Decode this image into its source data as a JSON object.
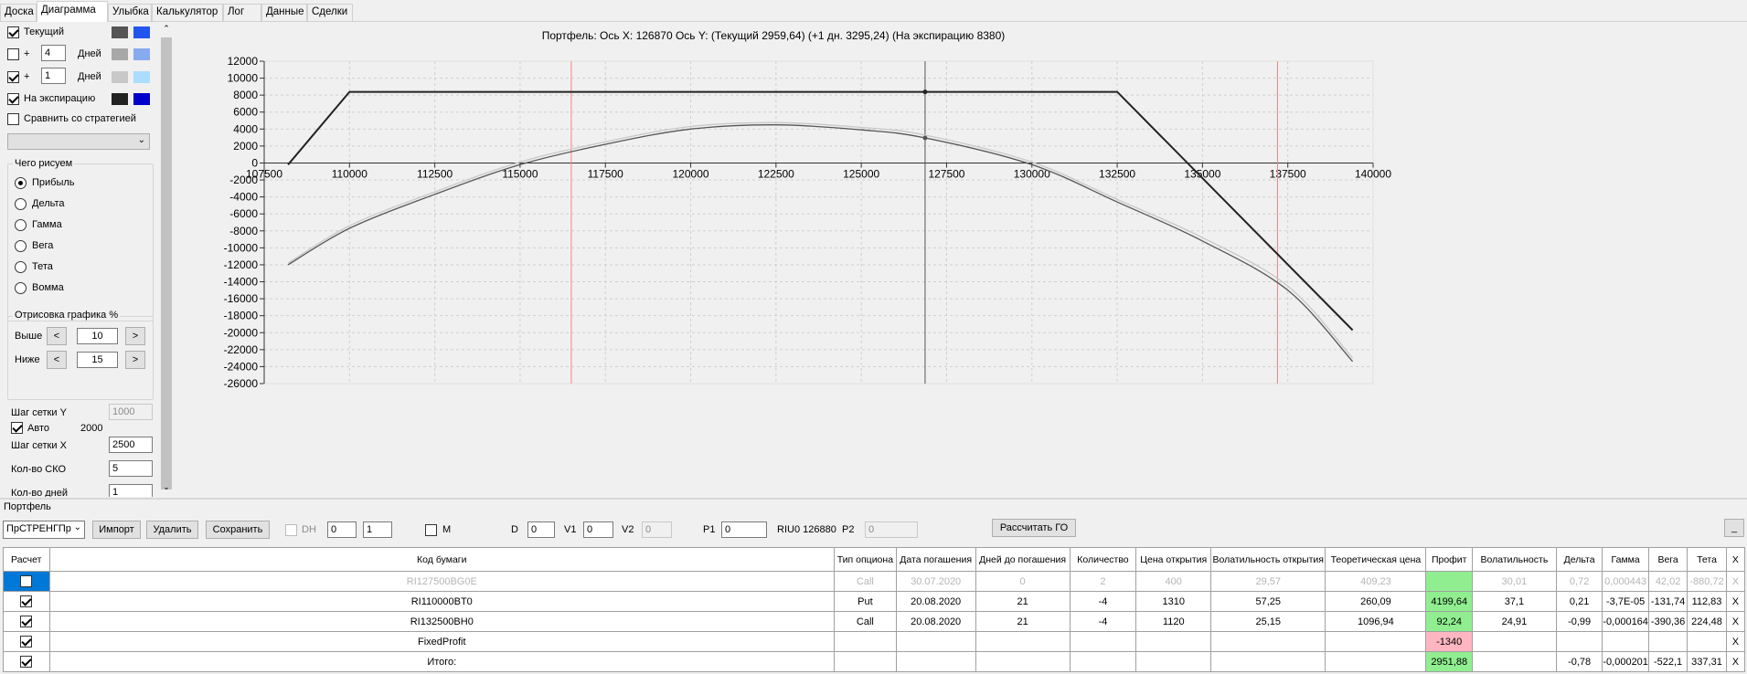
{
  "tabs": [
    "Доска",
    "Диаграмма",
    "Улыбка",
    "Калькулятор",
    "Лог",
    "Данные",
    "Сделки"
  ],
  "left": {
    "series": [
      {
        "label": "Текущий",
        "checked": true,
        "c1": "#555555",
        "c2": "#2255ee"
      },
      {
        "label": "+",
        "checked": false,
        "days": "4",
        "unit": "Дней",
        "c1": "#a8a8a8",
        "c2": "#88aaee"
      },
      {
        "label": "+",
        "checked": true,
        "days": "1",
        "unit": "Дней",
        "c1": "#c8c8c8",
        "c2": "#aaddff"
      },
      {
        "label": "На экспирацию",
        "checked": true,
        "c1": "#222222",
        "c2": "#0000cc"
      }
    ],
    "compare": "Сравнить со стратегией",
    "draw_group": "Чего рисуем",
    "radios": [
      "Прибыль",
      "Дельта",
      "Гамма",
      "Вега",
      "Тета",
      "Вомма"
    ],
    "selected_radio": "Прибыль",
    "pct_group": "Отрисовка графика %",
    "above_label": "Выше",
    "above_value": "10",
    "below_label": "Ниже",
    "below_value": "15",
    "grid_y_label": "Шаг сетки Y",
    "grid_y_value": "1000",
    "auto_label": "Авто",
    "auto_value": "2000",
    "grid_x_label": "Шаг сетки X",
    "grid_x_value": "2500",
    "sko_label": "Кол-во СКО",
    "sko_value": "5",
    "days_label": "Кол-во дней",
    "days_value": "1"
  },
  "chart_title": "Портфель: Ось X: 126870 Ось Y:  (Текущий 2959,64)  (+1 дн. 3295,24)  (На экспирацию 8380)",
  "chart_data": {
    "type": "line",
    "xlim": [
      107500,
      140000
    ],
    "ylim": [
      -26000,
      12000
    ],
    "x_ticks": [
      107500,
      110000,
      112500,
      115000,
      117500,
      120000,
      122500,
      125000,
      127500,
      130000,
      132500,
      135000,
      137500,
      140000
    ],
    "y_ticks": [
      12000,
      10000,
      8000,
      6000,
      4000,
      2000,
      0,
      -2000,
      -4000,
      -6000,
      -8000,
      -10000,
      -12000,
      -14000,
      -16000,
      -18000,
      -20000,
      -22000,
      -24000,
      -26000
    ],
    "cursor_x": 126870,
    "red_lines": [
      116500,
      137200
    ],
    "series": [
      {
        "color": "#222222",
        "x": [
          108200,
          110000,
          126870,
          132500,
          139400
        ],
        "y": [
          -200,
          8380,
          8380,
          8380,
          -19700
        ]
      },
      {
        "color": "#555555",
        "x": [
          108200,
          110000,
          112500,
          115000,
          117500,
          120000,
          122500,
          125000,
          126870,
          130000,
          132500,
          135000,
          137500,
          139400
        ],
        "y": [
          -12000,
          -7700,
          -3700,
          -200,
          2200,
          4000,
          4500,
          3900,
          2960,
          -200,
          -4600,
          -9200,
          -15000,
          -23400
        ]
      },
      {
        "color": "#c8c8c8",
        "x": [
          108200,
          110000,
          112500,
          115000,
          117500,
          120000,
          122500,
          125000,
          126870,
          130000,
          132500,
          135000,
          137500,
          139400
        ],
        "y": [
          -11800,
          -7400,
          -3400,
          100,
          2500,
          4300,
          4750,
          4200,
          3295,
          100,
          -4300,
          -8800,
          -14500,
          -23000
        ]
      }
    ]
  },
  "bottom": {
    "title": "Портфель",
    "portfolio_select": "ПрСТРЕНГПр",
    "import": "Импорт",
    "delete": "Удалить",
    "save": "Сохранить",
    "dh": "DH",
    "dh1": "0",
    "dh2": "1",
    "m": "M",
    "d_label": "D",
    "d_value": "0",
    "v1_label": "V1",
    "v1_value": "0",
    "v2_label": "V2",
    "v2_value": "0",
    "p1_label": "P1",
    "p1_value": "0",
    "riu": "RIU0 126880",
    "p2_label": "P2",
    "p2_value": "0",
    "calc_go": "Рассчитать ГО",
    "min_btn": "_",
    "headers": [
      "Расчет",
      "Код бумаги",
      "Тип опциона",
      "Дата погашения",
      "Дней до погашения",
      "Количество",
      "Цена открытия",
      "Волатильность открытия",
      "Теоретическая цена",
      "Профит",
      "Волатильность",
      "Дельта",
      "Гамма",
      "Вега",
      "Тета",
      "X"
    ],
    "rows": [
      {
        "check": false,
        "cells": [
          "RI127500BG0E",
          "Call",
          "30.07.2020",
          "0",
          "2",
          "400",
          "29,57",
          "409,23",
          "",
          "30,01",
          "0,72",
          "0,000443",
          "42,02",
          "-880,72",
          "X"
        ],
        "gray": true,
        "profit": "green"
      },
      {
        "check": true,
        "cells": [
          "RI110000BT0",
          "Put",
          "20.08.2020",
          "21",
          "-4",
          "1310",
          "57,25",
          "260,09",
          "4199,64",
          "37,1",
          "0,21",
          "-3,7E-05",
          "-131,74",
          "112,83",
          "X"
        ],
        "profit": "green"
      },
      {
        "check": true,
        "cells": [
          "RI132500BH0",
          "Call",
          "20.08.2020",
          "21",
          "-4",
          "1120",
          "25,15",
          "1096,94",
          "92,24",
          "24,91",
          "-0,99",
          "-0,000164",
          "-390,36",
          "224,48",
          "X"
        ],
        "profit": "green"
      },
      {
        "check": true,
        "cells": [
          "FixedProfit",
          "",
          "",
          "",
          "",
          "",
          "",
          "",
          "-1340",
          "",
          "",
          "",
          "",
          "",
          "X"
        ],
        "profit": "red"
      },
      {
        "check": true,
        "cells": [
          "Итого:",
          "",
          "",
          "",
          "",
          "",
          "",
          "",
          "2951,88",
          "",
          "-0,78",
          "-0,000201",
          "-522,1",
          "337,31",
          "X"
        ],
        "profit": "green"
      }
    ]
  }
}
